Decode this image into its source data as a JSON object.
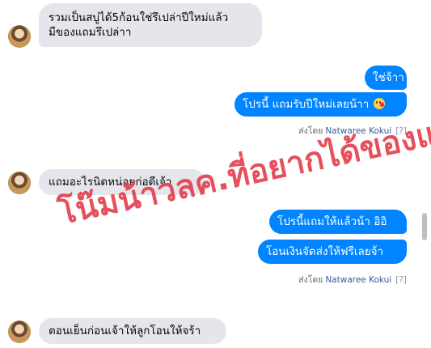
{
  "messages": [
    {
      "side": "in",
      "lines": [
        "รวมเป็นสบู่ได้5ก้อนใช่รึเปล่าปีใหม่แล้ว",
        "มีของแถมรึเปล่าา"
      ]
    },
    {
      "side": "out",
      "text": "ใช่จ้าา"
    },
    {
      "side": "out",
      "text": "โปรนี้ แถมรับปีใหม่เลยน้าา",
      "emoji": "kissing-heart-emoji"
    },
    {
      "side": "in",
      "text": "แถมอะไรนิดหน่อยก่อดีเจ้า"
    },
    {
      "side": "out",
      "text": "โปรนี้แถมให้แล้วน้า อิอิ"
    },
    {
      "side": "out",
      "text": "โอนเงินจัดส่งให้ฟรีเลยจ้า"
    },
    {
      "side": "in",
      "text": "ตอนเย็นก่อนเจ้าให้ลูกโอนให้จร้า"
    }
  ],
  "seen_receipts": [
    {
      "prefix": "ส่งโดย",
      "name": "Natwaree Kokui",
      "help": "[?]"
    },
    {
      "prefix": "ส่งโดย",
      "name": "Natwaree Kokui",
      "help": "[?]"
    }
  ],
  "watermark": "โน๊มน้าวลค.ที่อยากได้ของแถม",
  "colors": {
    "outgoing": "#0084ff",
    "incoming": "#e4e6eb",
    "watermark": "#e02838",
    "sender_name": "#385898"
  }
}
